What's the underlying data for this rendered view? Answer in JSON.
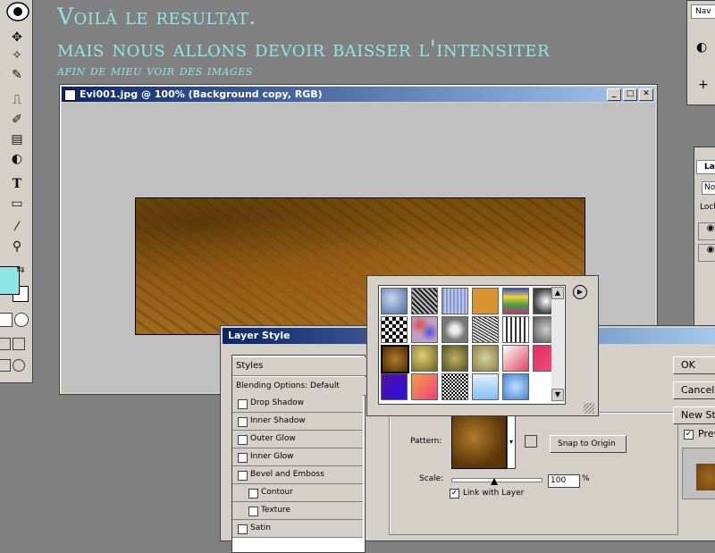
{
  "tutorial": {
    "line1": "Voilà le resultat.",
    "line2": "mais nous allons devoir baisser l'intensiter",
    "line3": "afin de mieu voir des images"
  },
  "document": {
    "title": "Evi001.jpg @ 100% (Background copy, RGB)"
  },
  "panels": {
    "top_tab": "Nav",
    "layers_tab": "La",
    "blend_select": "Nor",
    "lock_label": "Lock"
  },
  "layer_style": {
    "title": "Layer Style",
    "styles_header": "Styles",
    "blending_options": "Blending Options: Default",
    "items": [
      {
        "label": "Drop Shadow"
      },
      {
        "label": "Inner Shadow"
      },
      {
        "label": "Outer Glow"
      },
      {
        "label": "Inner Glow"
      },
      {
        "label": "Bevel and Emboss"
      },
      {
        "label": "Contour"
      },
      {
        "label": "Texture"
      },
      {
        "label": "Satin"
      }
    ],
    "pattern_label": "Pattern:",
    "snap_label": "Snap to Origin",
    "scale_label": "Scale:",
    "scale_value": "100",
    "scale_unit": "%",
    "link_label": "Link with Layer",
    "link_checked": true,
    "ok_label": "OK",
    "cancel_label": "Cancel",
    "new_style_label": "New Style...",
    "preview_label": "Preview",
    "preview_checked": true
  },
  "tools": [
    {
      "icon": "move-icon"
    },
    {
      "icon": "magic-wand-icon"
    },
    {
      "icon": "brush-icon"
    },
    {
      "icon": "stamp-icon"
    },
    {
      "icon": "history-brush-icon"
    },
    {
      "icon": "gradient-icon"
    },
    {
      "icon": "dodge-icon"
    },
    {
      "icon": "type-icon"
    },
    {
      "icon": "shape-icon"
    },
    {
      "icon": "eyedropper-icon"
    },
    {
      "icon": "zoom-icon"
    }
  ],
  "colors": {
    "foreground": "#8fe6e6",
    "background": "#ffffff",
    "tutorial_text": "#8fe6e6",
    "titlebar_start": "#0a246a",
    "titlebar_end": "#a6caf0"
  }
}
